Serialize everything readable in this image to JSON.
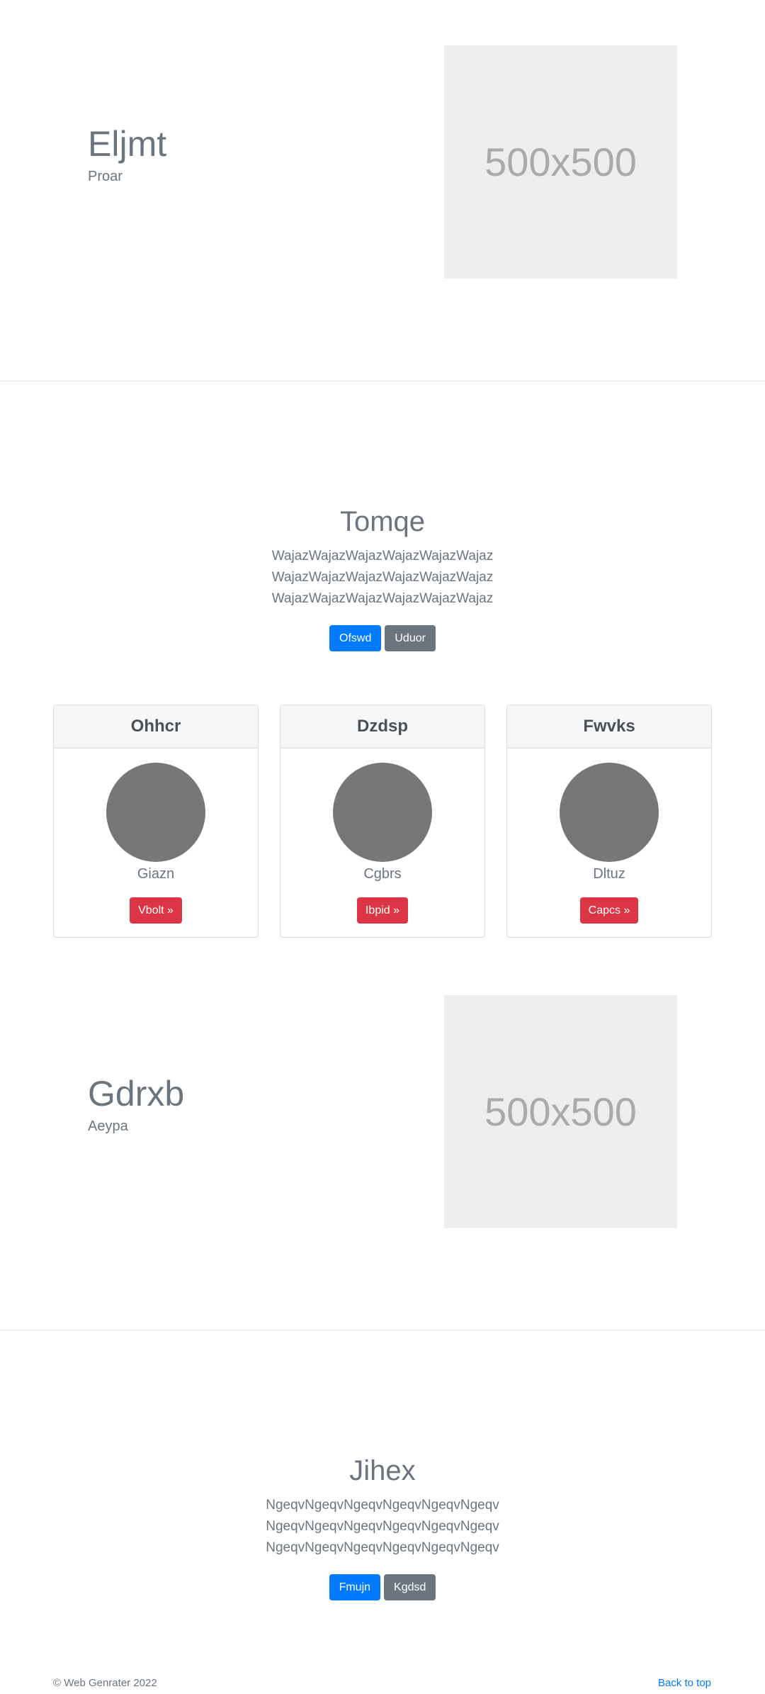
{
  "section1": {
    "title": "Eljmt",
    "subtitle": "Proar",
    "image_text": "500x500"
  },
  "section2": {
    "title": "Tomqe",
    "text": "WajazWajazWajazWajazWajazWajaz WajazWajazWajazWajazWajazWajaz WajazWajazWajazWajazWajazWajaz",
    "primary_button": "Ofswd",
    "secondary_button": "Uduor"
  },
  "cards": [
    {
      "header": "Ohhcr",
      "name": "Giazn",
      "button": "Vbolt »"
    },
    {
      "header": "Dzdsp",
      "name": "Cgbrs",
      "button": "Ibpid »"
    },
    {
      "header": "Fwvks",
      "name": "Dltuz",
      "button": "Capcs »"
    }
  ],
  "section3": {
    "title": "Gdrxb",
    "subtitle": "Aeypa",
    "image_text": "500x500"
  },
  "section4": {
    "title": "Jihex",
    "text": "NgeqvNgeqvNgeqvNgeqvNgeqvNgeqv NgeqvNgeqvNgeqvNgeqvNgeqvNgeqv NgeqvNgeqvNgeqvNgeqvNgeqvNgeqv",
    "primary_button": "Fmujn",
    "secondary_button": "Kgdsd"
  },
  "footer": {
    "copyright": "© Web Genrater 2022",
    "back_to_top": "Back to top"
  },
  "colors": {
    "primary": "#007bff",
    "secondary": "#6c757d",
    "danger": "#dc3545",
    "placeholder_bg": "#eeeeee",
    "avatar": "#777777"
  }
}
